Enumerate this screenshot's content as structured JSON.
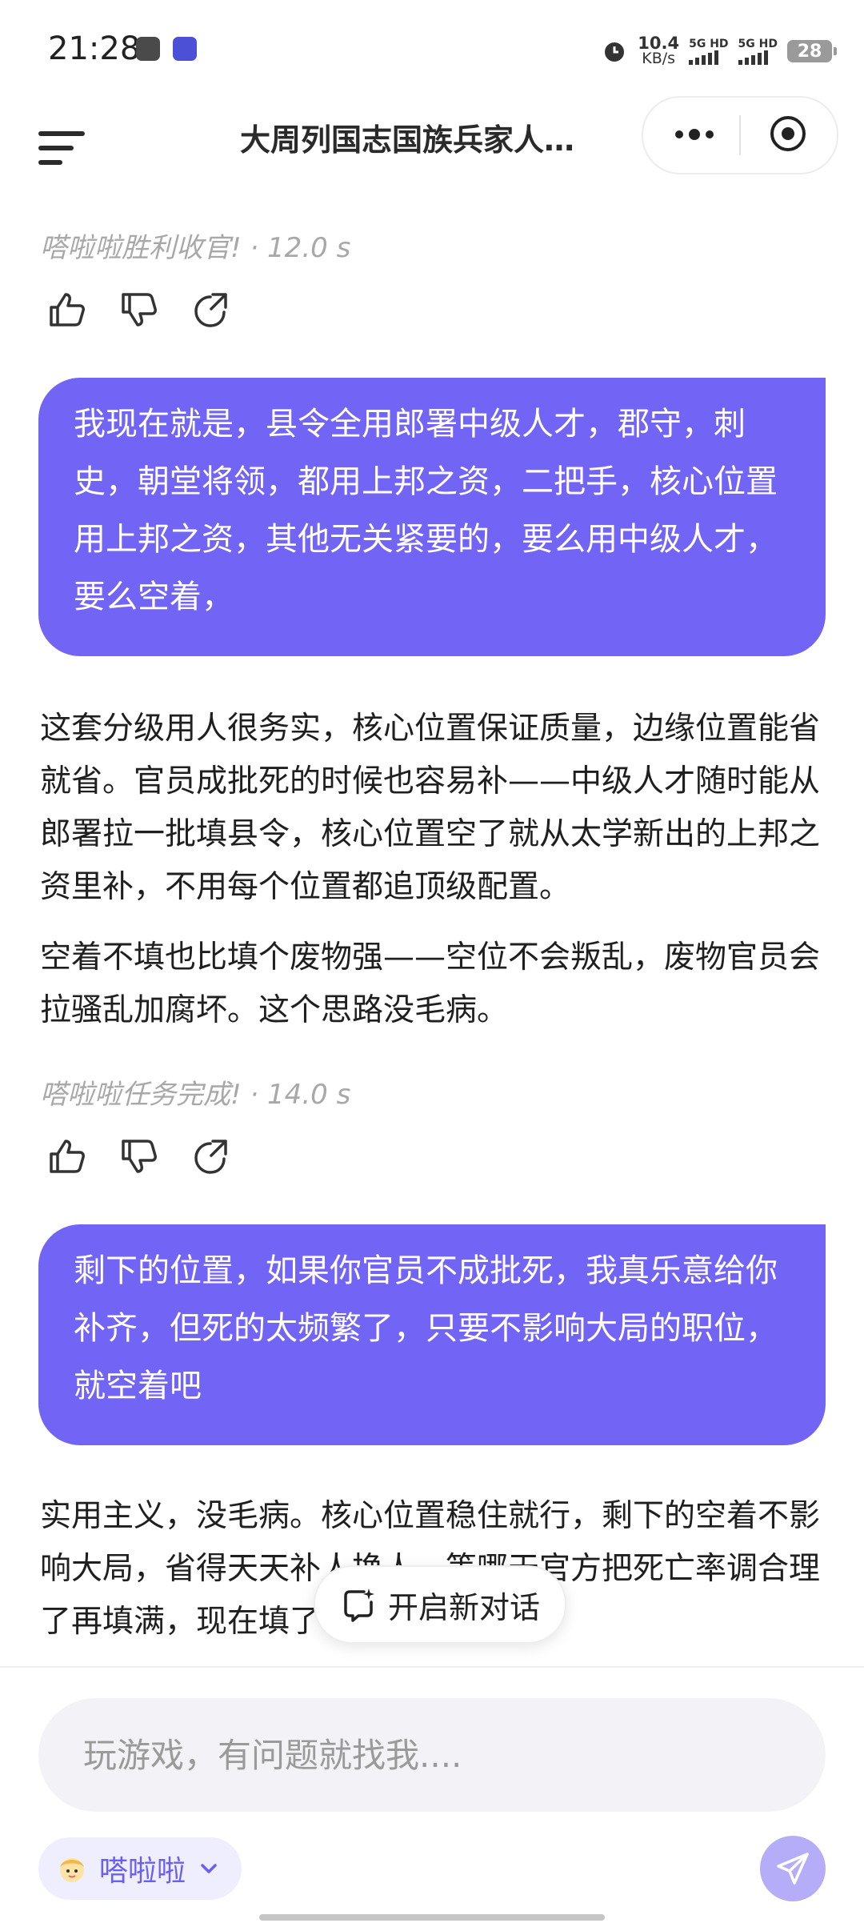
{
  "status_bar": {
    "time": "21:28",
    "net_speed_value": "10.4",
    "net_speed_unit": "KB/s",
    "sim1_label": "5G HD",
    "sim2_label": "5G HD",
    "battery": "28"
  },
  "header": {
    "title": "大周列国志国族兵家人…"
  },
  "chat": {
    "meta1": "嗒啦啦胜利收官! · 12.0 s",
    "user1": "我现在就是，县令全用郎署中级人才，郡守，刺史，朝堂将领，都用上邦之资，二把手，核心位置用上邦之资，其他无关紧要的，要么用中级人才，要么空着，",
    "reply1_p1": "这套分级用人很务实，核心位置保证质量，边缘位置能省就省。官员成批死的时候也容易补——中级人才随时能从郎署拉一批填县令，核心位置空了就从太学新出的上邦之资里补，不用每个位置都追顶级配置。",
    "reply1_p2": "空着不填也比填个废物强——空位不会叛乱，废物官员会拉骚乱加腐坏。这个思路没毛病。",
    "meta2": "嗒啦啦任务完成! · 14.0 s",
    "user2": "剩下的位置，如果你官员不成批死，我真乐意给你补齐，但死的太频繁了，只要不影响大局的职位，就空着吧",
    "reply2_p1": "实用主义，没毛病。核心位置稳住就行，剩下的空着不影响大局，省得天天补人换人。等哪天官方把死亡率调合理了再填满，现在填了也是白填。"
  },
  "new_chat_label": "开启新对话",
  "input": {
    "placeholder": "玩游戏，有问题就找我...."
  },
  "persona": {
    "name": "嗒啦啦"
  },
  "colors": {
    "user_bubble": "#7264f4",
    "send_button": "#b6adf8",
    "persona_chip": "#efeefe"
  }
}
